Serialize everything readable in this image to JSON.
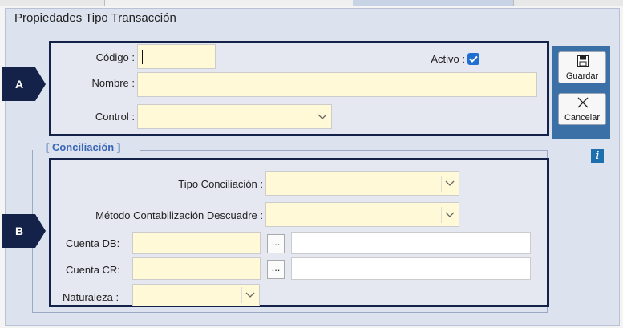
{
  "dialog": {
    "title": "Propiedades Tipo Transacción"
  },
  "section_a": {
    "marker": "A",
    "codigo_label": "Código :",
    "codigo_value": "",
    "activo_label": "Activo :",
    "activo_checked": true,
    "nombre_label": "Nombre :",
    "nombre_value": "",
    "control_label": "Control :",
    "control_value": ""
  },
  "section_b": {
    "marker": "B",
    "group_title": "[ Conciliación ]",
    "tipo_conciliacion_label": "Tipo Conciliación :",
    "tipo_conciliacion_value": "",
    "metodo_label": "Método Contabilización Descuadre :",
    "metodo_value": "",
    "cuenta_db_label": "Cuenta DB:",
    "cuenta_db_value": "",
    "cuenta_db_desc": "",
    "cuenta_cr_label": "Cuenta CR:",
    "cuenta_cr_value": "",
    "cuenta_cr_desc": "",
    "browse_label": "...",
    "naturaleza_label": "Naturaleza :",
    "naturaleza_value": ""
  },
  "toolbar": {
    "save_label": "Guardar",
    "cancel_label": "Cancelar",
    "info_label": "i"
  },
  "colors": {
    "accent": "#3b70a7",
    "panel_border": "#14224a",
    "marker": "#14224a",
    "field_bg": "#fff9d7",
    "checkbox": "#1f6fd1",
    "group_title": "#3a66b6"
  },
  "icons": {
    "save": "floppy-disk-icon",
    "cancel": "close-x-icon",
    "info": "info-icon",
    "dropdown": "chevron-down-icon",
    "check": "check-icon"
  }
}
